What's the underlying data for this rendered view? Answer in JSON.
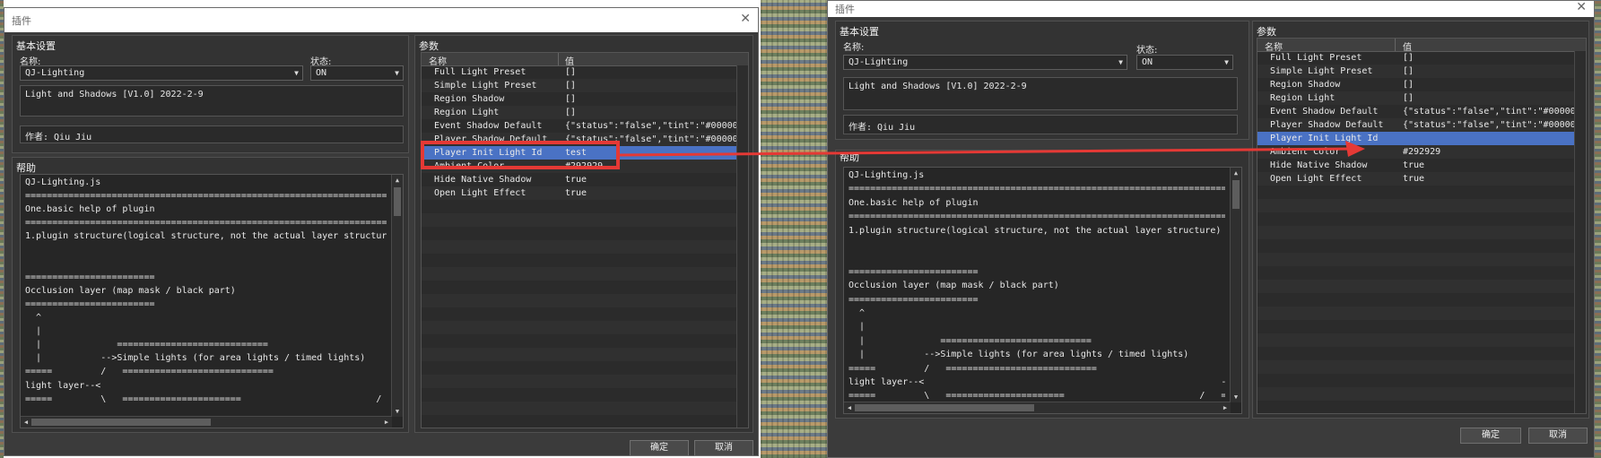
{
  "dialog": {
    "title": "插件",
    "basic_group": "基本设置",
    "name_label": "名称:",
    "name_value": "QJ-Lighting",
    "status_label": "状态:",
    "status_value": "ON",
    "description": "Light and Shadows [V1.0] 2022-2-9",
    "author": "作者: Qiu Jiu",
    "help_group": "帮助",
    "params_group": "参数",
    "col_name": "名称",
    "col_value": "值",
    "ok": "确定",
    "cancel": "取消",
    "help_lines": [
      "QJ-Lighting.js",
      "=============================================================================",
      "One.basic help of plugin",
      "=============================================================================",
      "1.plugin structure(logical structure, not the actual layer structure)",
      "",
      "",
      "========================",
      "Occlusion layer (map mask / black part)",
      "========================",
      "  ^",
      "  |",
      "  |              ============================",
      "  |           -->Simple lights (for area lights / timed lights)",
      "=====         /   ============================                             ==========",
      "light layer--<                                                       -->Real time",
      "=====         \\   ======================                         /   =========="
    ]
  },
  "left_params": [
    {
      "name": "Full Light Preset",
      "value": "[]"
    },
    {
      "name": "Simple Light Preset",
      "value": "[]"
    },
    {
      "name": "Region Shadow",
      "value": "[]"
    },
    {
      "name": "Region Light",
      "value": "[]"
    },
    {
      "name": "Event Shadow Default",
      "value": "{\"status\":\"false\",\"tint\":\"#000000…"
    },
    {
      "name": "Player Shadow Default",
      "value": "{\"status\":\"false\",\"tint\":\"#000000…"
    },
    {
      "name": "Player Init Light Id",
      "value": "test"
    },
    {
      "name": "Ambient Color",
      "value": "#292929"
    },
    {
      "name": "Hide Native Shadow",
      "value": "true"
    },
    {
      "name": "Open Light Effect",
      "value": "true"
    }
  ],
  "right_params": [
    {
      "name": "Full Light Preset",
      "value": "[]"
    },
    {
      "name": "Simple Light Preset",
      "value": "[]"
    },
    {
      "name": "Region Shadow",
      "value": "[]"
    },
    {
      "name": "Region Light",
      "value": "[]"
    },
    {
      "name": "Event Shadow Default",
      "value": "{\"status\":\"false\",\"tint\":\"#000000…"
    },
    {
      "name": "Player Shadow Default",
      "value": "{\"status\":\"false\",\"tint\":\"#000000…"
    },
    {
      "name": "Player Init Light Id",
      "value": ""
    },
    {
      "name": "Ambient Color",
      "value": "#292929"
    },
    {
      "name": "Hide Native Shadow",
      "value": "true"
    },
    {
      "name": "Open Light Effect",
      "value": "true"
    }
  ],
  "selected_index": 6,
  "colors": {
    "selection": "#4a72c4",
    "annotation": "#e53935",
    "panel_bg": "#3b3b3b"
  }
}
